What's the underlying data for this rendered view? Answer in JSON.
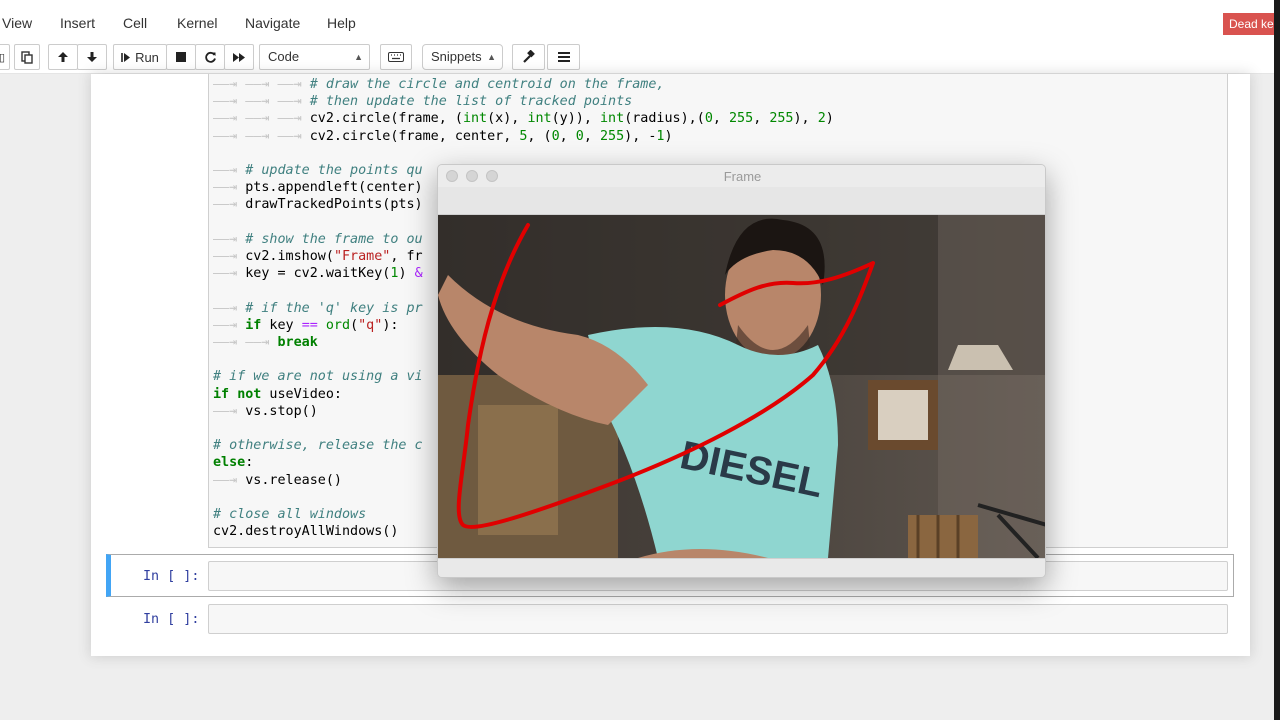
{
  "menu": [
    "View",
    "Insert",
    "Cell",
    "Kernel",
    "Navigate",
    "Help"
  ],
  "kernel_status": "Dead kernel",
  "toolbar": {
    "run_label": "Run",
    "cell_type": "Code",
    "snippets": "Snippets"
  },
  "code_lines": [
    "\t\t\t# draw the circle and centroid on the frame,",
    "\t\t\t# then update the list of tracked points",
    "\t\t\tcv2.circle(frame, (int(x), int(y)), int(radius),(0, 255, 255), 2)",
    "\t\t\tcv2.circle(frame, center, 5, (0, 0, 255), -1)",
    "",
    "\t# update the points qu",
    "\tpts.appendleft(center)",
    "\tdrawTrackedPoints(pts)",
    "",
    "\t# show the frame to ou",
    "\tcv2.imshow(\"Frame\", fr",
    "\tkey = cv2.waitKey(1) &",
    "",
    "\t# if the 'q' key is pr",
    "\tif key == ord(\"q\"):",
    "\t\tbreak",
    "",
    "# if we are not using a vi",
    "if not useVideo:",
    "\tvs.stop()",
    "",
    "# otherwise, release the c",
    "else:",
    "\tvs.release()",
    "",
    "# close all windows",
    "cv2.destroyAllWindows()"
  ],
  "prompts": [
    "In [ ]:",
    "In [ ]:"
  ],
  "frame_window": {
    "title": "Frame"
  },
  "colors": {
    "kernel_badge": "#d9534f",
    "selected_cell_border": "#42a5f5",
    "prompt": "#303f9f",
    "trace": "#e00000"
  }
}
